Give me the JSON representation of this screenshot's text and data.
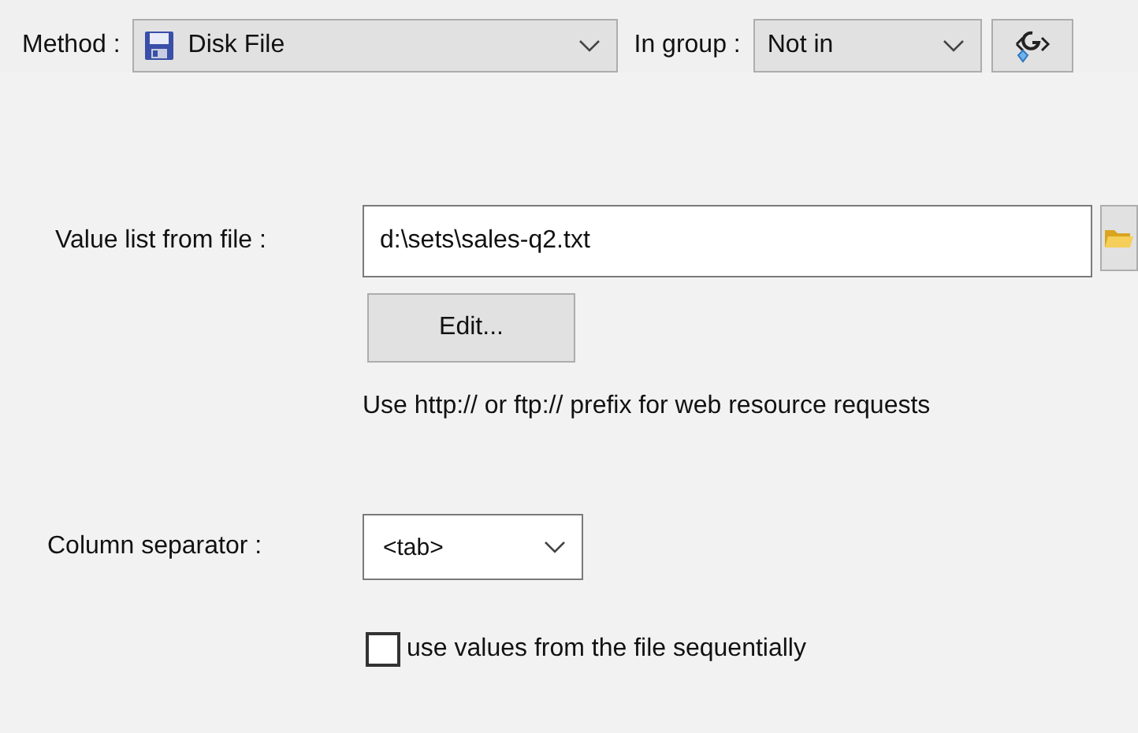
{
  "method": {
    "label": "Method :",
    "value": "Disk File"
  },
  "group": {
    "label": "In group :",
    "value": "Not in"
  },
  "value_list": {
    "label": "Value list from file :",
    "value": "d:\\sets\\sales-q2.txt",
    "edit_button": "Edit...",
    "hint": "Use http:// or ftp:// prefix for web resource requests"
  },
  "separator": {
    "label": "Column separator :",
    "value": "<tab>"
  },
  "sequential": {
    "label": "use values from the file sequentially",
    "checked": false
  }
}
